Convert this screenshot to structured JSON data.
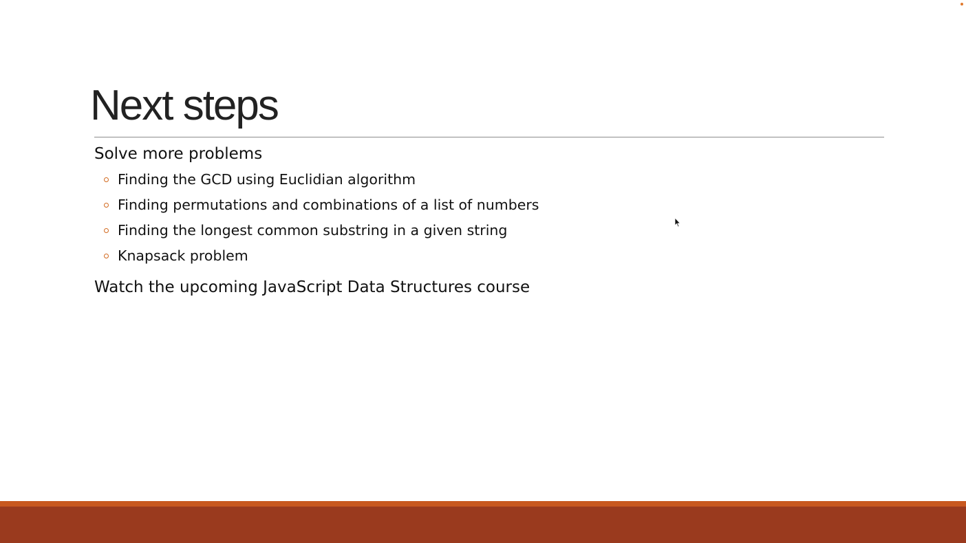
{
  "slide": {
    "title": "Next steps",
    "bullets": [
      {
        "text": "Solve more problems",
        "sub_bullets": [
          "Finding the GCD using Euclidian algorithm",
          "Finding permutations and combinations of a list of numbers",
          "Finding the longest common substring in a given string",
          "Knapsack problem"
        ]
      },
      {
        "text": "Watch the upcoming JavaScript Data Structures course"
      }
    ]
  },
  "theme": {
    "accent_color": "#c8581f",
    "footer_color": "#9a3a1e",
    "bullet_color": "#d2691e",
    "title_color": "#222222"
  },
  "icons": {
    "sub_bullet": "hollow-circle-bullet-icon",
    "pointer": "mouse-pointer-icon",
    "corner": "orange-dot-icon"
  }
}
